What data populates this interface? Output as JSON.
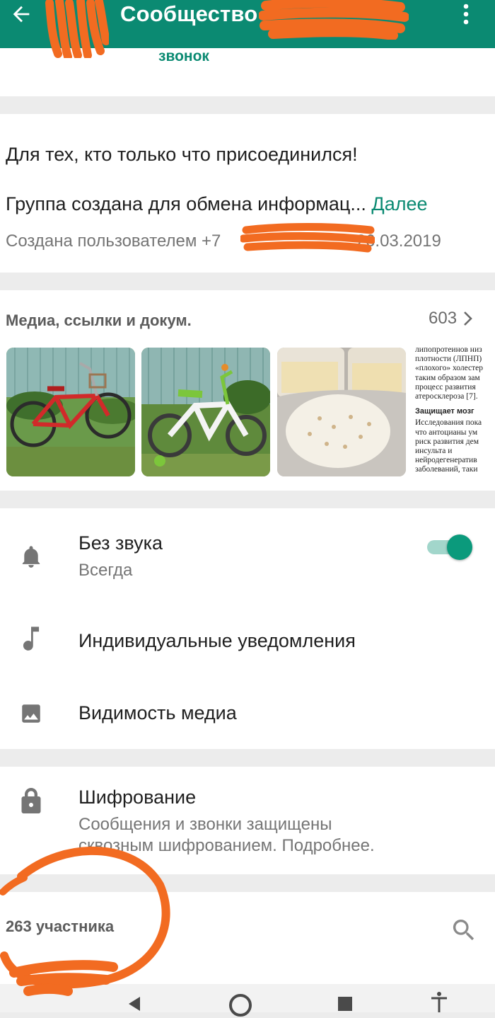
{
  "header": {
    "title": "Сообщество",
    "back_icon": "arrow-back-icon",
    "menu_icon": "more-vert-icon",
    "background": "#0b8a72"
  },
  "call": {
    "label": "звонок"
  },
  "description": {
    "line1": "Для тех, кто только что присоединился!",
    "line2": "Группа создана для обмена информац...",
    "more": "Далее",
    "created_prefix": "Создана пользователем +7",
    "created_suffix": ", 26.03.2019"
  },
  "media": {
    "title": "Медиа, ссылки и докум.",
    "count": "603",
    "thumbnails": [
      "red-bicycle-photo",
      "white-green-bicycle-photo",
      "food-container-photo",
      "document-text-photo"
    ],
    "doc_preview": {
      "lines_top": [
        "липопротеинов низ",
        "плотности (ЛПНП)",
        "«плохого» холестер",
        "таким образом зам",
        "процесс развития",
        "атеросклероза [7]."
      ],
      "heading": "Защищает мозг",
      "lines_bottom": [
        "Исследования пока",
        "что антоцианы ум",
        "риск развития дем",
        "инсульта и",
        "нейродегенератив",
        "заболеваний, таки"
      ]
    }
  },
  "settings": {
    "mute": {
      "title": "Без звука",
      "subtitle": "Всегда",
      "icon": "bell-icon",
      "enabled": true
    },
    "custom_notifications": {
      "title": "Индивидуальные уведомления",
      "icon": "music-note-icon"
    },
    "media_visibility": {
      "title": "Видимость медиа",
      "icon": "image-icon"
    }
  },
  "encryption": {
    "title": "Шифрование",
    "line1": "Сообщения и звонки защищены",
    "line2": "сквозным шифрованием. Подробнее.",
    "icon": "lock-icon"
  },
  "participants": {
    "label": "263 участника",
    "search_icon": "search-icon"
  },
  "colors": {
    "accent": "#0b8a72",
    "link": "#0b8a72",
    "toggle_on": "#0b9a7c"
  }
}
